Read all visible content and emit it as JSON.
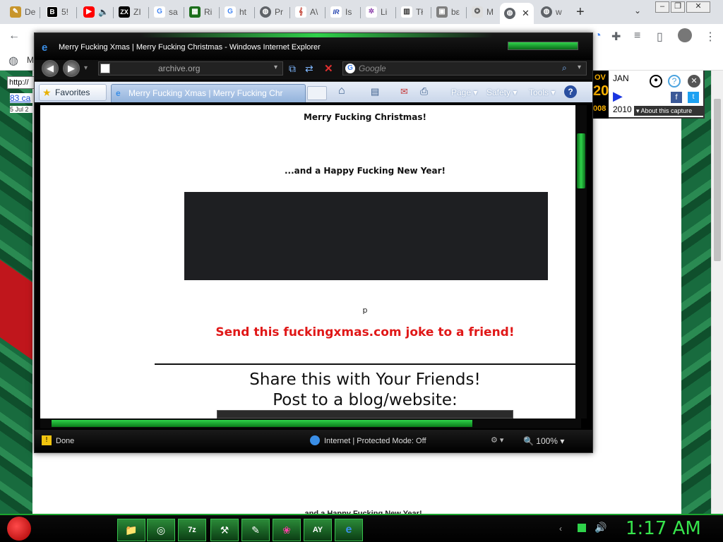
{
  "chrome": {
    "tabs": [
      {
        "label": "De",
        "icon": "pen-icon",
        "color": "#c8952b"
      },
      {
        "label": "5!",
        "icon": "b-icon",
        "color": "#000000"
      },
      {
        "label": "",
        "icon": "youtube-icon",
        "color": "#ff0000"
      },
      {
        "label": "ZI",
        "icon": "zx-icon",
        "color": "#000000"
      },
      {
        "label": "sa",
        "icon": "google-icon",
        "color": "#4285f4"
      },
      {
        "label": "Ri",
        "icon": "game-icon",
        "color": "#1b6e1b"
      },
      {
        "label": "ht",
        "icon": "google-icon",
        "color": "#4285f4"
      },
      {
        "label": "Pr",
        "icon": "globe-icon",
        "color": "#5f6368"
      },
      {
        "label": "A\\",
        "icon": "music-icon",
        "color": "#c0392b"
      },
      {
        "label": "Is",
        "icon": "ir-icon",
        "color": "#1e3fae"
      },
      {
        "label": "Li",
        "icon": "network-icon",
        "color": "#8e44ad"
      },
      {
        "label": "Tł",
        "icon": "chart-icon",
        "color": "#333333"
      },
      {
        "label": "bε",
        "icon": "photo-icon",
        "color": "#7f7f7f"
      },
      {
        "label": "M",
        "icon": "wiki-icon",
        "color": "#999999"
      },
      {
        "label": "",
        "icon": "globe-icon",
        "color": "#5f6368"
      },
      {
        "label": "w",
        "icon": "globe-icon",
        "color": "#5f6368"
      }
    ],
    "new_tab": "+"
  },
  "page_left": {
    "url_fragment": "http://",
    "captures": "83 ca",
    "date": "5 Jul 2"
  },
  "wayback": {
    "prev_month": "OV",
    "month": "JAN",
    "day": "20",
    "prev_year": "008",
    "year": "2010",
    "about": "About this capture"
  },
  "ie": {
    "title": "Merry Fucking Xmas | Merry Fucking Christmas - Windows Internet Explorer",
    "address": "archive.org",
    "search_placeholder": "Google",
    "favorites": "Favorites",
    "tab_title": "Merry Fucking Xmas | Merry Fucking Chr",
    "menu": {
      "page": "Page",
      "safety": "Safety",
      "tools": "Tools"
    },
    "status": {
      "done": "Done",
      "zone": "Internet | Protected Mode: Off",
      "zoom": "100%"
    }
  },
  "content": {
    "heading1": "Merry Fucking Christmas!",
    "heading2": "...and a Happy Fucking New Year!",
    "p_char": "p",
    "send_link": "Send this fuckingxmas.com joke to a friend!",
    "share1": "Share this with Your Friends!",
    "share2": "Post to a blog/website:"
  },
  "below_text": "...and a Happy Fucking New Year!",
  "taskbar": {
    "clock": "1:17 AM",
    "apps": [
      "folder-icon",
      "chrome-icon",
      "7z-icon",
      "tool-icon",
      "pen-icon",
      "pink-icon",
      "ay-icon",
      "ie-icon"
    ]
  }
}
